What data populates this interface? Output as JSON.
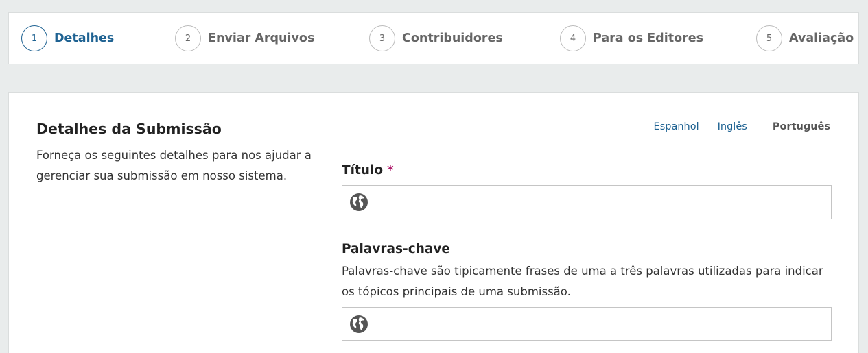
{
  "steps": [
    {
      "number": "1",
      "label": "Detalhes",
      "active": true
    },
    {
      "number": "2",
      "label": "Enviar Arquivos",
      "active": false
    },
    {
      "number": "3",
      "label": "Contribuidores",
      "active": false
    },
    {
      "number": "4",
      "label": "Para os Editores",
      "active": false
    },
    {
      "number": "5",
      "label": "Avaliação",
      "active": false
    }
  ],
  "section": {
    "title": "Detalhes da Submissão",
    "description": "Forneça os seguintes detalhes para nos ajudar a gerenciar sua submissão em nosso sistema."
  },
  "languages": [
    {
      "label": "Espanhol",
      "current": false
    },
    {
      "label": "Inglês",
      "current": false
    },
    {
      "label": "Português",
      "current": true
    }
  ],
  "fields": {
    "title": {
      "label": "Título",
      "required_mark": "*",
      "value": "",
      "icon": "globe-icon"
    },
    "keywords": {
      "label": "Palavras-chave",
      "description": "Palavras-chave são tipicamente frases de uma a três palavras utilizadas para indicar os tópicos principais de uma submissão.",
      "value": "",
      "icon": "globe-icon"
    }
  },
  "colors": {
    "accent": "#1e6292",
    "required": "#b01c6c",
    "background": "#e9ecec"
  }
}
